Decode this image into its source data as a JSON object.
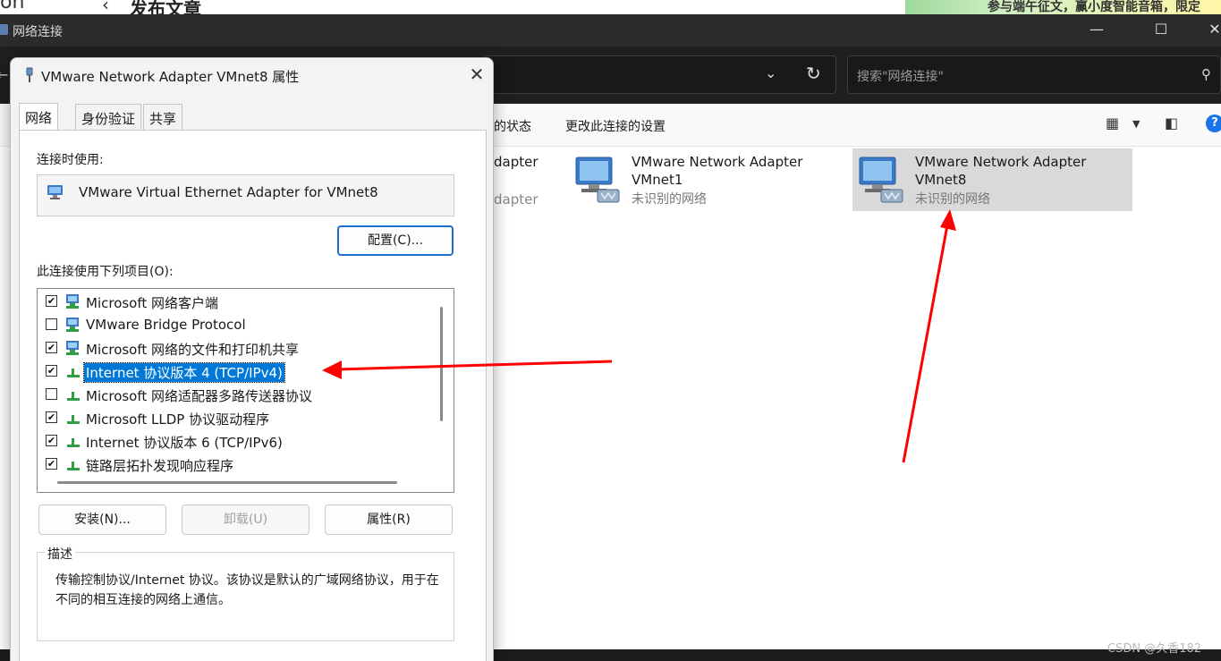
{
  "background_page": {
    "title": "发布文章",
    "banner_text": "参与端午征文，赢小度智能音箱，限定"
  },
  "explorer": {
    "window_title": "网络连接",
    "controls": {
      "minimize": "—",
      "maximize": "☐",
      "close": "✕"
    },
    "search_placeholder": "搜索\"网络连接\"",
    "commands": {
      "status": "的状态",
      "change_settings": "更改此连接的设置"
    },
    "partial_adapter": {
      "name_fragment": "dapter",
      "sub_fragment": "dapter"
    },
    "adapters": [
      {
        "name_line1": "VMware Network Adapter",
        "name_line2": "VMnet1",
        "status": "未识别的网络",
        "selected": false
      },
      {
        "name_line1": "VMware Network Adapter",
        "name_line2": "VMnet8",
        "status": "未识别的网络",
        "selected": true
      }
    ]
  },
  "dialog": {
    "title": "VMware Network Adapter VMnet8 属性",
    "tabs": [
      {
        "label": "网络",
        "active": true
      },
      {
        "label": "身份验证",
        "active": false
      },
      {
        "label": "共享",
        "active": false
      }
    ],
    "connect_using_label": "连接时使用:",
    "adapter_name": "VMware Virtual Ethernet Adapter for VMnet8",
    "configure_button": "配置(C)...",
    "items_label": "此连接使用下列项目(O):",
    "items": [
      {
        "label": "Microsoft 网络客户端",
        "checked": true,
        "icon": "network-client-icon"
      },
      {
        "label": "VMware Bridge Protocol",
        "checked": false,
        "icon": "network-client-icon"
      },
      {
        "label": "Microsoft 网络的文件和打印机共享",
        "checked": true,
        "icon": "network-client-icon"
      },
      {
        "label": "Internet 协议版本 4 (TCP/IPv4)",
        "checked": true,
        "icon": "protocol-icon",
        "selected": true
      },
      {
        "label": "Microsoft 网络适配器多路传送器协议",
        "checked": false,
        "icon": "protocol-icon"
      },
      {
        "label": "Microsoft LLDP 协议驱动程序",
        "checked": true,
        "icon": "protocol-icon"
      },
      {
        "label": "Internet 协议版本 6 (TCP/IPv6)",
        "checked": true,
        "icon": "protocol-icon"
      },
      {
        "label": "链路层拓扑发现响应程序",
        "checked": true,
        "icon": "protocol-icon"
      }
    ],
    "buttons": {
      "install": "安装(N)...",
      "uninstall": "卸载(U)",
      "properties": "属性(R)"
    },
    "description_legend": "描述",
    "description_text": "传输控制协议/Internet 协议。该协议是默认的广域网络协议，用于在不同的相互连接的网络上通信。"
  },
  "watermark": "CSDN @久香182",
  "colors": {
    "annotation_arrow": "#ff0000",
    "selection": "#0078d7",
    "titlebar": "#2b2b2b"
  }
}
